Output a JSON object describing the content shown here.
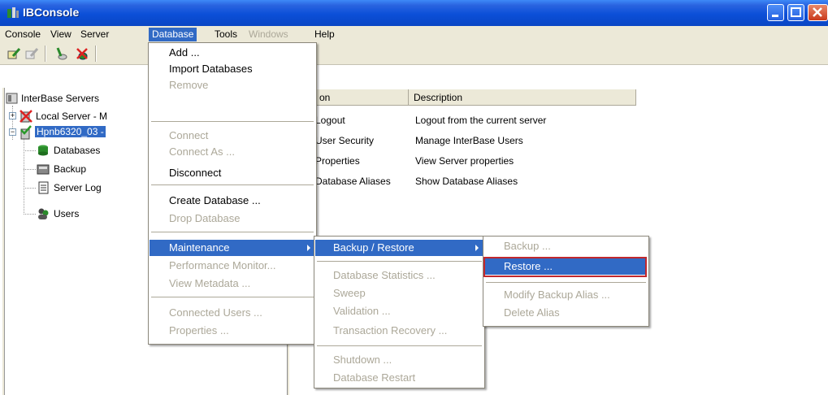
{
  "window": {
    "title": "IBConsole"
  },
  "menubar": {
    "items": [
      {
        "label": "Console"
      },
      {
        "label": "View"
      },
      {
        "label": "Server"
      },
      {
        "label": "Database"
      },
      {
        "label": "Tools"
      },
      {
        "label": "Windows"
      },
      {
        "label": "Help"
      }
    ]
  },
  "tree": {
    "root": "InterBase Servers",
    "local_server": "Local Server - M",
    "server": "Hpnb6320_03 -",
    "children": [
      "Databases",
      "Backup",
      "Server Log",
      "Users"
    ]
  },
  "list": {
    "columns": [
      "on",
      "Description"
    ],
    "rows": [
      {
        "action": "Logout",
        "description": "Logout from the current server"
      },
      {
        "action": "User Security",
        "description": "Manage InterBase Users"
      },
      {
        "action": "Properties",
        "description": "View Server properties"
      },
      {
        "action": "Database Aliases",
        "description": "Show Database Aliases"
      }
    ]
  },
  "database_menu": {
    "add": "Add ...",
    "import": "Import Databases",
    "remove": "Remove",
    "connect": "Connect",
    "connect_as": "Connect As ...",
    "disconnect": "Disconnect",
    "create": "Create Database ...",
    "drop": "Drop Database",
    "maintenance": "Maintenance",
    "perf": "Performance Monitor...",
    "metadata": "View Metadata ...",
    "connected_users": "Connected Users ...",
    "properties": "Properties ..."
  },
  "maintenance_menu": {
    "backup_restore": "Backup / Restore",
    "stats": "Database Statistics ...",
    "sweep": "Sweep",
    "validation": "Validation ...",
    "tx_recovery": "Transaction Recovery ...",
    "shutdown": "Shutdown ...",
    "restart": "Database Restart"
  },
  "backup_menu": {
    "backup": "Backup ...",
    "restore": "Restore ...",
    "modify_alias": "Modify Backup Alias ...",
    "delete_alias": "Delete Alias"
  },
  "colors": {
    "highlight": "#316ac5",
    "titlebar": "#0b4fd8",
    "callout": "#c0282e"
  }
}
